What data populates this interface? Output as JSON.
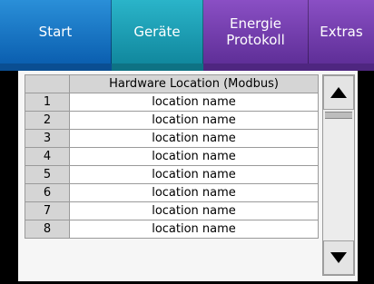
{
  "tabs": [
    {
      "label": "Start",
      "color": "#0b5fb0"
    },
    {
      "label": "Geräte",
      "color": "#11889e"
    },
    {
      "label": "Energie Protokoll",
      "line1": "Energie",
      "line2": "Protokoll",
      "color": "#5f2f98"
    },
    {
      "label": "Extras",
      "color": "#5f2f98"
    }
  ],
  "table": {
    "header": "Hardware Location (Modbus)",
    "rows": [
      {
        "num": "1",
        "name": "location name"
      },
      {
        "num": "2",
        "name": "location name"
      },
      {
        "num": "3",
        "name": "location name"
      },
      {
        "num": "4",
        "name": "location name"
      },
      {
        "num": "5",
        "name": "location name"
      },
      {
        "num": "6",
        "name": "location name"
      },
      {
        "num": "7",
        "name": "location name"
      },
      {
        "num": "8",
        "name": "location name"
      }
    ]
  },
  "scrollbar": {
    "up_icon": "triangle-up-icon",
    "down_icon": "triangle-down-icon"
  }
}
